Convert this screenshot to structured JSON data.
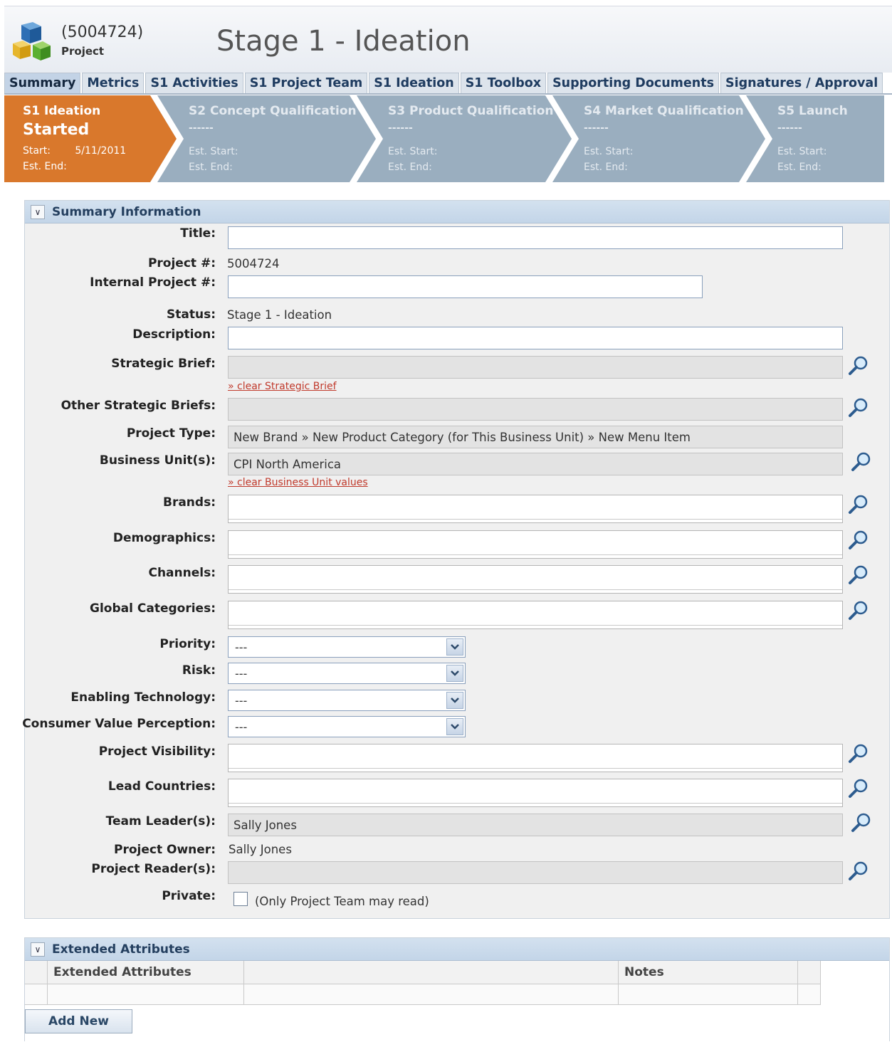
{
  "header": {
    "project_number": "(5004724)",
    "project_label": "Project",
    "title": "Stage 1 - Ideation",
    "logo_icon": "cubes-icon"
  },
  "tabs": [
    {
      "label": "Summary",
      "active": true
    },
    {
      "label": "Metrics"
    },
    {
      "label": "S1 Activities"
    },
    {
      "label": "S1 Project Team"
    },
    {
      "label": "S1 Ideation"
    },
    {
      "label": "S1 Toolbox"
    },
    {
      "label": "Supporting Documents"
    },
    {
      "label": "Signatures / Approval"
    }
  ],
  "stages": [
    {
      "name": "S1 Ideation",
      "status": "Started",
      "start_label": "Start:",
      "start_value": "5/11/2011",
      "end_label": "Est. End:",
      "active": true
    },
    {
      "name": "S2 Concept Qualification",
      "status": "------",
      "start_label": "Est. Start:",
      "end_label": "Est. End:"
    },
    {
      "name": "S3 Product Qualification",
      "status": "------",
      "start_label": "Est. Start:",
      "end_label": "Est. End:"
    },
    {
      "name": "S4 Market Qualification",
      "status": "------",
      "start_label": "Est. Start:",
      "end_label": "Est. End:"
    },
    {
      "name": "S5 Launch",
      "status": "------",
      "start_label": "Est. Start:",
      "end_label": "Est. End:"
    }
  ],
  "colors": {
    "active_stage": "#d9782c",
    "inactive_stage": "#9aaebf",
    "link": "#c0392b",
    "panel_head": "#c9d9ea"
  },
  "summary": {
    "heading": "Summary Information",
    "fields": {
      "title": {
        "label": "Title:",
        "value": ""
      },
      "project_num": {
        "label": "Project #:",
        "value": "5004724"
      },
      "internal_project_num": {
        "label": "Internal Project #:",
        "value": ""
      },
      "status": {
        "label": "Status:",
        "value": "Stage 1 - Ideation"
      },
      "description": {
        "label": "Description:",
        "value": ""
      },
      "strategic_brief": {
        "label": "Strategic Brief:",
        "value": "",
        "clear_link": "» clear Strategic Brief"
      },
      "other_strategic_briefs": {
        "label": "Other Strategic Briefs:",
        "value": ""
      },
      "project_type": {
        "label": "Project Type:",
        "value": "New Brand » New Product Category (for This Business Unit) » New Menu Item"
      },
      "business_units": {
        "label": "Business Unit(s):",
        "value": "CPI North America",
        "clear_link": "» clear Business Unit values"
      },
      "brands": {
        "label": "Brands:",
        "value": ""
      },
      "demographics": {
        "label": "Demographics:",
        "value": ""
      },
      "channels": {
        "label": "Channels:",
        "value": ""
      },
      "global_categories": {
        "label": "Global Categories:",
        "value": ""
      },
      "priority": {
        "label": "Priority:",
        "value": "---"
      },
      "risk": {
        "label": "Risk:",
        "value": "---"
      },
      "enabling_technology": {
        "label": "Enabling Technology:",
        "value": "---"
      },
      "consumer_value_perception": {
        "label": "Consumer Value Perception:",
        "value": "---"
      },
      "project_visibility": {
        "label": "Project Visibility:",
        "value": ""
      },
      "lead_countries": {
        "label": "Lead Countries:",
        "value": ""
      },
      "team_leaders": {
        "label": "Team Leader(s):",
        "value": "Sally Jones"
      },
      "project_owner": {
        "label": "Project Owner:",
        "value": "Sally Jones"
      },
      "project_readers": {
        "label": "Project Reader(s):",
        "value": ""
      },
      "private": {
        "label": "Private:",
        "checked": false,
        "note": "(Only Project Team may read)"
      }
    }
  },
  "extended": {
    "heading": "Extended Attributes",
    "columns": [
      "Extended Attributes",
      "",
      "Notes"
    ],
    "add_button": "Add New"
  }
}
